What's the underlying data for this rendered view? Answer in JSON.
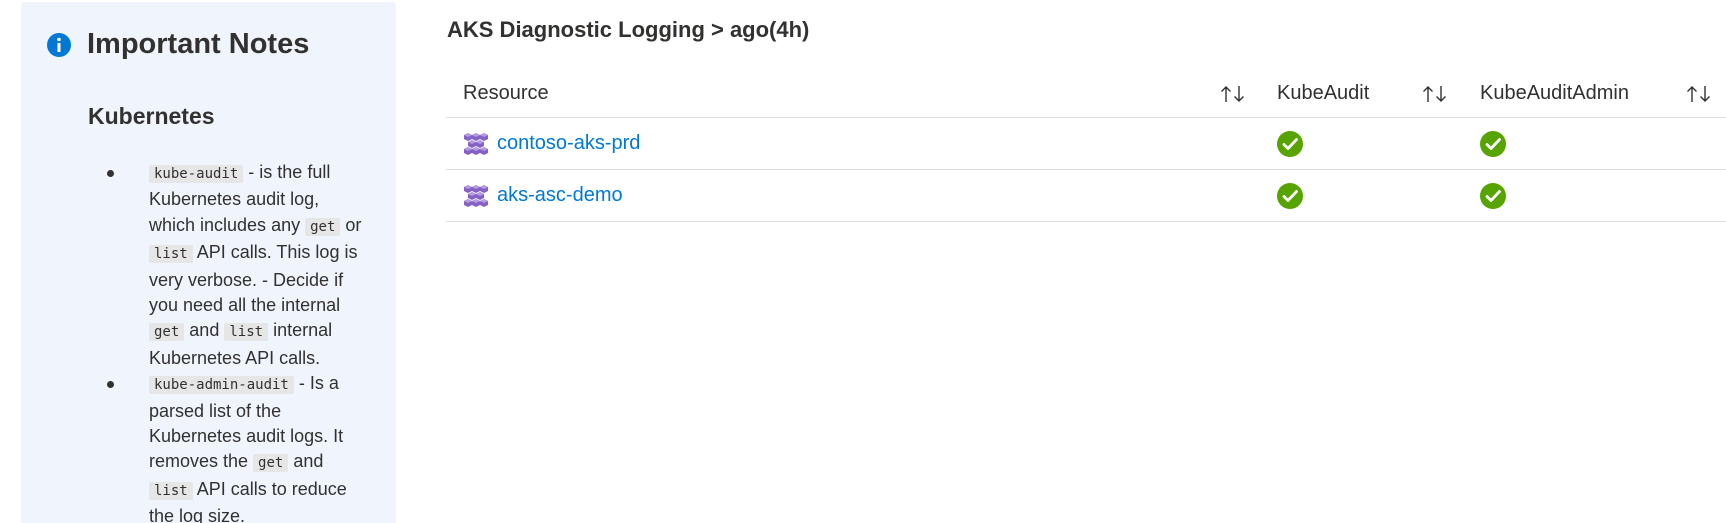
{
  "notes": {
    "title": "Important Notes",
    "subtitle": "Kubernetes",
    "items": [
      {
        "code": "kube-audit",
        "t1": " - is the full Kubernetes audit log, which includes any ",
        "code2": "get",
        "t2": " or ",
        "code3": "list",
        "t3": " API calls. This log is very verbose. - Decide if you need all the internal ",
        "code4": "get",
        "t4": " and ",
        "code5": "list",
        "t5": " internal Kubernetes API calls."
      },
      {
        "code": "kube-admin-audit",
        "t1": " - Is a parsed list of the Kubernetes audit logs. It removes the ",
        "code2": "get",
        "t2": " and ",
        "code3": "list",
        "t3": " API calls to reduce the log size."
      }
    ]
  },
  "grid": {
    "title": "AKS Diagnostic Logging > ago(4h)",
    "columns": [
      "Resource",
      "KubeAudit",
      "KubeAuditAdmin"
    ],
    "rows": [
      {
        "resource": "contoso-aks-prd",
        "kubeaudit": "check-icon",
        "kubeauditadmin": "check-icon"
      },
      {
        "resource": "aks-asc-demo",
        "kubeaudit": "check-icon",
        "kubeauditadmin": "check-icon"
      }
    ]
  },
  "colors": {
    "panel_bg": "#eff4fd",
    "info_icon": "#0078d4",
    "link": "#0078d4",
    "check": "#57a300",
    "aks_icon": "#8661c5"
  }
}
